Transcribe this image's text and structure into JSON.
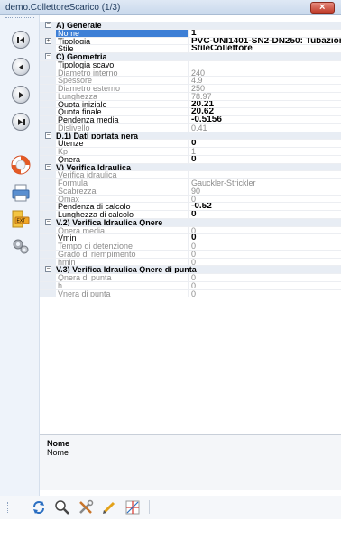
{
  "window": {
    "title": "demo.CollettoreScarico (1/3)",
    "close_label": "×"
  },
  "rows": [
    {
      "kind": "cat",
      "label": "A) Generale"
    },
    {
      "kind": "prop",
      "label": "Nome",
      "value": "1",
      "style": "bold",
      "selected": true
    },
    {
      "kind": "prop",
      "label": "Tipologia",
      "value": "PVC-UNI1401-SN2-DN250: Tubazione",
      "style": "bold",
      "expand": "+"
    },
    {
      "kind": "prop",
      "label": "Stile",
      "value": "StileCollettore",
      "style": "bold"
    },
    {
      "kind": "cat",
      "label": "C) Geometria"
    },
    {
      "kind": "prop",
      "label": "Tipologia scavo",
      "value": "",
      "style": "normal"
    },
    {
      "kind": "prop",
      "label": "Diametro interno",
      "value": "240",
      "style": "dim"
    },
    {
      "kind": "prop",
      "label": "Spessore",
      "value": "4.9",
      "style": "dim"
    },
    {
      "kind": "prop",
      "label": "Diametro esterno",
      "value": "250",
      "style": "dim"
    },
    {
      "kind": "prop",
      "label": "Lunghezza",
      "value": "78.97",
      "style": "dim"
    },
    {
      "kind": "prop",
      "label": "Quota iniziale",
      "value": "20.21",
      "style": "bold"
    },
    {
      "kind": "prop",
      "label": "Quota finale",
      "value": "20.62",
      "style": "bold"
    },
    {
      "kind": "prop",
      "label": "Pendenza media",
      "value": "-0.5156",
      "style": "bold"
    },
    {
      "kind": "prop",
      "label": "Dislivello",
      "value": "0.41",
      "style": "dim"
    },
    {
      "kind": "cat",
      "label": "D.1) Dati portata nera"
    },
    {
      "kind": "prop",
      "label": "Utenze",
      "value": "0",
      "style": "bold"
    },
    {
      "kind": "prop",
      "label": "Kp",
      "value": "1",
      "style": "dim"
    },
    {
      "kind": "prop",
      "label": "Qnera",
      "value": "0",
      "style": "bold"
    },
    {
      "kind": "cat",
      "label": "V) Verifica Idraulica"
    },
    {
      "kind": "prop",
      "label": "Verifica idraulica",
      "value": "",
      "style": "dim"
    },
    {
      "kind": "prop",
      "label": "Formula",
      "value": "Gauckler-Strickler",
      "style": "dim"
    },
    {
      "kind": "prop",
      "label": "Scabrezza",
      "value": "90",
      "style": "dim"
    },
    {
      "kind": "prop",
      "label": "Qmax",
      "value": "0",
      "style": "dim"
    },
    {
      "kind": "prop",
      "label": "Pendenza di calcolo",
      "value": "-0.52",
      "style": "bold"
    },
    {
      "kind": "prop",
      "label": "Lunghezza di calcolo",
      "value": "0",
      "style": "bold"
    },
    {
      "kind": "cat",
      "label": "V.2) Verifica Idraulica Qnere"
    },
    {
      "kind": "prop",
      "label": "Qnera media",
      "value": "0",
      "style": "dim"
    },
    {
      "kind": "prop",
      "label": "Vmin",
      "value": "0",
      "style": "bold"
    },
    {
      "kind": "prop",
      "label": "Tempo di detenzione",
      "value": "0",
      "style": "dim"
    },
    {
      "kind": "prop",
      "label": "Grado di riempimento",
      "value": "0",
      "style": "dim"
    },
    {
      "kind": "prop",
      "label": "hmin",
      "value": "0",
      "style": "dim"
    },
    {
      "kind": "cat",
      "label": "V.3) Verifica Idraulica Qnere di punta"
    },
    {
      "kind": "prop",
      "label": "Qnera di punta",
      "value": "0",
      "style": "dim"
    },
    {
      "kind": "prop",
      "label": "h",
      "value": "0",
      "style": "dim"
    },
    {
      "kind": "prop",
      "label": "Vnera di punta",
      "value": "0",
      "style": "dim"
    }
  ],
  "description": {
    "title": "Nome",
    "text": "Nome"
  },
  "sidebar_icons": [
    "first-record-icon",
    "previous-record-icon",
    "next-record-icon",
    "last-record-icon",
    "help-lifebuoy-icon",
    "print-icon",
    "export-icon",
    "settings-gears-icon"
  ],
  "toolbar_icons": [
    "refresh-icon",
    "zoom-icon",
    "tools-icon",
    "pencil-icon",
    "chart-icon"
  ],
  "colors": {
    "selection": "#3d7fd6",
    "category_bg": "#e8edf4",
    "dim_text": "#8c8c8c",
    "close_button": "#c13c2b"
  }
}
